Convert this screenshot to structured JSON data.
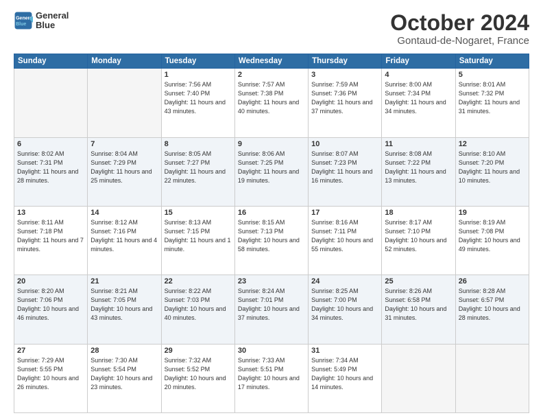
{
  "header": {
    "logo_line1": "General",
    "logo_line2": "Blue",
    "month": "October 2024",
    "location": "Gontaud-de-Nogaret, France"
  },
  "weekdays": [
    "Sunday",
    "Monday",
    "Tuesday",
    "Wednesday",
    "Thursday",
    "Friday",
    "Saturday"
  ],
  "weeks": [
    [
      {
        "day": "",
        "info": ""
      },
      {
        "day": "",
        "info": ""
      },
      {
        "day": "1",
        "info": "Sunrise: 7:56 AM\nSunset: 7:40 PM\nDaylight: 11 hours\nand 43 minutes."
      },
      {
        "day": "2",
        "info": "Sunrise: 7:57 AM\nSunset: 7:38 PM\nDaylight: 11 hours\nand 40 minutes."
      },
      {
        "day": "3",
        "info": "Sunrise: 7:59 AM\nSunset: 7:36 PM\nDaylight: 11 hours\nand 37 minutes."
      },
      {
        "day": "4",
        "info": "Sunrise: 8:00 AM\nSunset: 7:34 PM\nDaylight: 11 hours\nand 34 minutes."
      },
      {
        "day": "5",
        "info": "Sunrise: 8:01 AM\nSunset: 7:32 PM\nDaylight: 11 hours\nand 31 minutes."
      }
    ],
    [
      {
        "day": "6",
        "info": "Sunrise: 8:02 AM\nSunset: 7:31 PM\nDaylight: 11 hours\nand 28 minutes."
      },
      {
        "day": "7",
        "info": "Sunrise: 8:04 AM\nSunset: 7:29 PM\nDaylight: 11 hours\nand 25 minutes."
      },
      {
        "day": "8",
        "info": "Sunrise: 8:05 AM\nSunset: 7:27 PM\nDaylight: 11 hours\nand 22 minutes."
      },
      {
        "day": "9",
        "info": "Sunrise: 8:06 AM\nSunset: 7:25 PM\nDaylight: 11 hours\nand 19 minutes."
      },
      {
        "day": "10",
        "info": "Sunrise: 8:07 AM\nSunset: 7:23 PM\nDaylight: 11 hours\nand 16 minutes."
      },
      {
        "day": "11",
        "info": "Sunrise: 8:08 AM\nSunset: 7:22 PM\nDaylight: 11 hours\nand 13 minutes."
      },
      {
        "day": "12",
        "info": "Sunrise: 8:10 AM\nSunset: 7:20 PM\nDaylight: 11 hours\nand 10 minutes."
      }
    ],
    [
      {
        "day": "13",
        "info": "Sunrise: 8:11 AM\nSunset: 7:18 PM\nDaylight: 11 hours\nand 7 minutes."
      },
      {
        "day": "14",
        "info": "Sunrise: 8:12 AM\nSunset: 7:16 PM\nDaylight: 11 hours\nand 4 minutes."
      },
      {
        "day": "15",
        "info": "Sunrise: 8:13 AM\nSunset: 7:15 PM\nDaylight: 11 hours\nand 1 minute."
      },
      {
        "day": "16",
        "info": "Sunrise: 8:15 AM\nSunset: 7:13 PM\nDaylight: 10 hours\nand 58 minutes."
      },
      {
        "day": "17",
        "info": "Sunrise: 8:16 AM\nSunset: 7:11 PM\nDaylight: 10 hours\nand 55 minutes."
      },
      {
        "day": "18",
        "info": "Sunrise: 8:17 AM\nSunset: 7:10 PM\nDaylight: 10 hours\nand 52 minutes."
      },
      {
        "day": "19",
        "info": "Sunrise: 8:19 AM\nSunset: 7:08 PM\nDaylight: 10 hours\nand 49 minutes."
      }
    ],
    [
      {
        "day": "20",
        "info": "Sunrise: 8:20 AM\nSunset: 7:06 PM\nDaylight: 10 hours\nand 46 minutes."
      },
      {
        "day": "21",
        "info": "Sunrise: 8:21 AM\nSunset: 7:05 PM\nDaylight: 10 hours\nand 43 minutes."
      },
      {
        "day": "22",
        "info": "Sunrise: 8:22 AM\nSunset: 7:03 PM\nDaylight: 10 hours\nand 40 minutes."
      },
      {
        "day": "23",
        "info": "Sunrise: 8:24 AM\nSunset: 7:01 PM\nDaylight: 10 hours\nand 37 minutes."
      },
      {
        "day": "24",
        "info": "Sunrise: 8:25 AM\nSunset: 7:00 PM\nDaylight: 10 hours\nand 34 minutes."
      },
      {
        "day": "25",
        "info": "Sunrise: 8:26 AM\nSunset: 6:58 PM\nDaylight: 10 hours\nand 31 minutes."
      },
      {
        "day": "26",
        "info": "Sunrise: 8:28 AM\nSunset: 6:57 PM\nDaylight: 10 hours\nand 28 minutes."
      }
    ],
    [
      {
        "day": "27",
        "info": "Sunrise: 7:29 AM\nSunset: 5:55 PM\nDaylight: 10 hours\nand 26 minutes."
      },
      {
        "day": "28",
        "info": "Sunrise: 7:30 AM\nSunset: 5:54 PM\nDaylight: 10 hours\nand 23 minutes."
      },
      {
        "day": "29",
        "info": "Sunrise: 7:32 AM\nSunset: 5:52 PM\nDaylight: 10 hours\nand 20 minutes."
      },
      {
        "day": "30",
        "info": "Sunrise: 7:33 AM\nSunset: 5:51 PM\nDaylight: 10 hours\nand 17 minutes."
      },
      {
        "day": "31",
        "info": "Sunrise: 7:34 AM\nSunset: 5:49 PM\nDaylight: 10 hours\nand 14 minutes."
      },
      {
        "day": "",
        "info": ""
      },
      {
        "day": "",
        "info": ""
      }
    ]
  ]
}
